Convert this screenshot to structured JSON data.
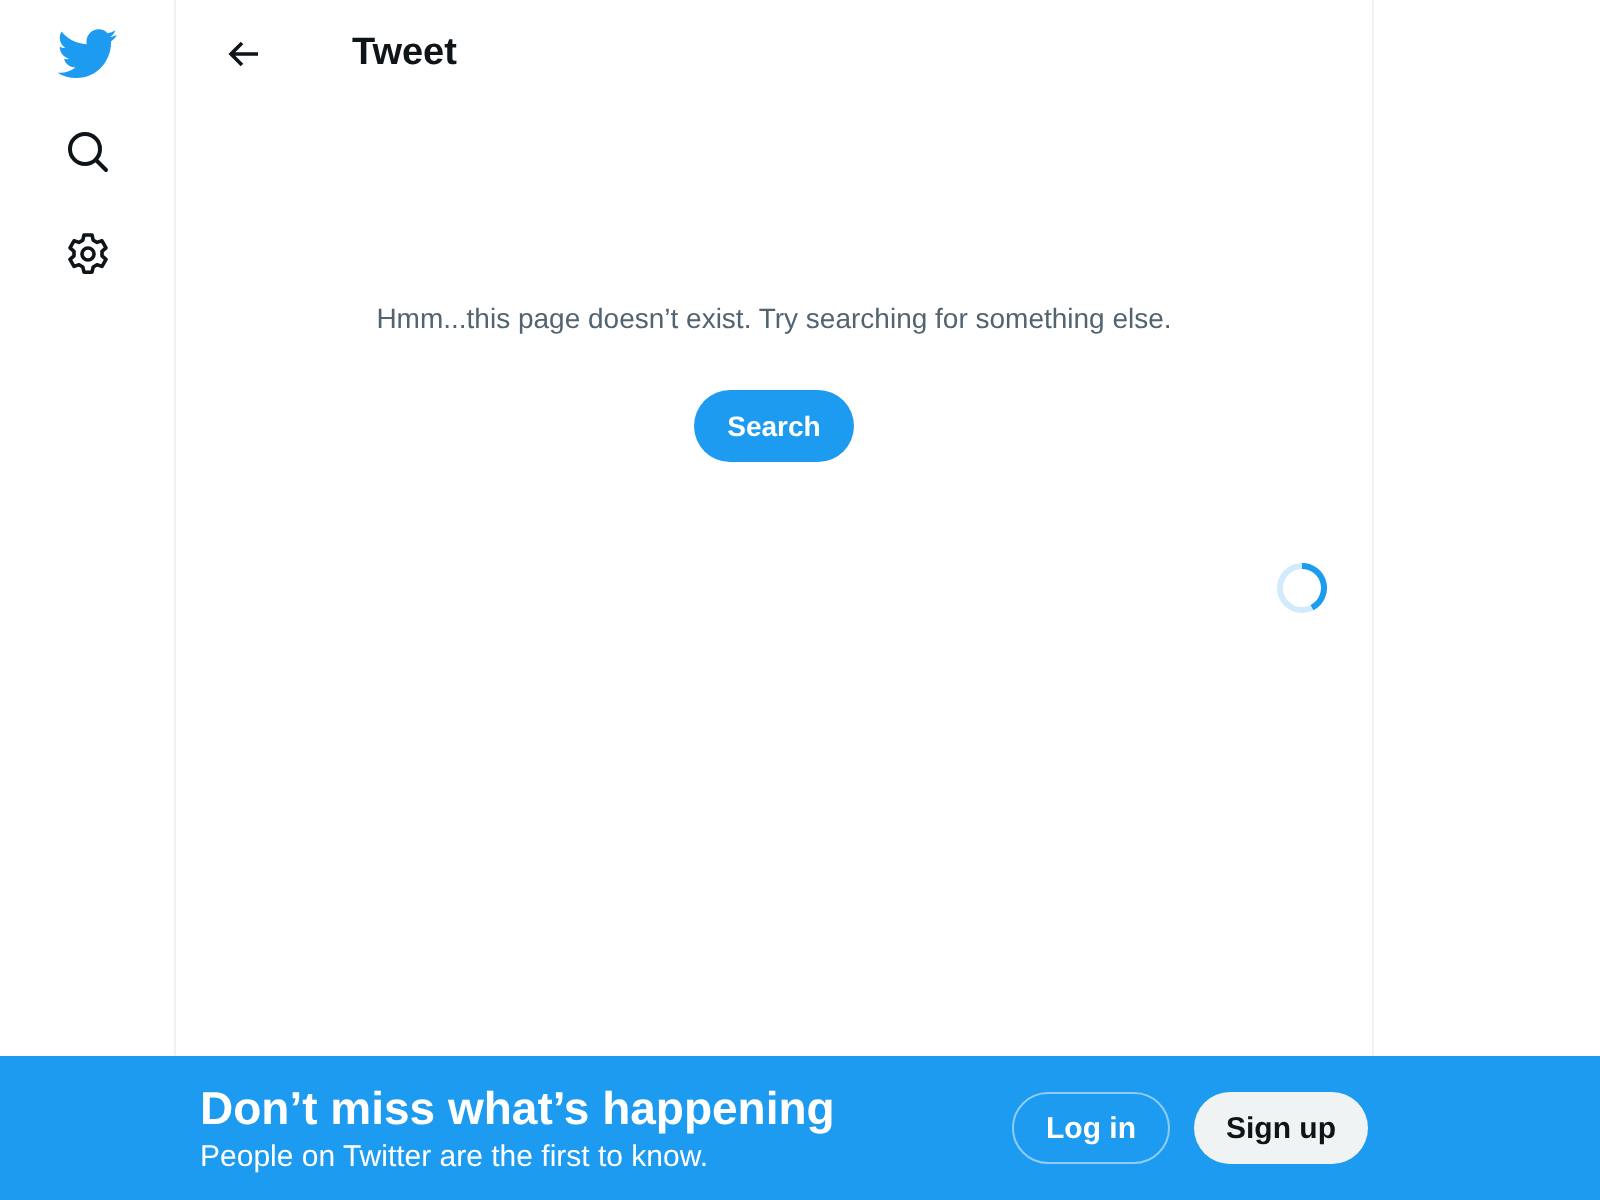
{
  "header": {
    "title": "Tweet"
  },
  "message": "Hmm...this page doesn’t exist. Try searching for something else.",
  "search_button": "Search",
  "banner": {
    "title": "Don’t miss what’s happening",
    "subtitle": "People on Twitter are the first to know.",
    "login": "Log in",
    "signup": "Sign up"
  }
}
